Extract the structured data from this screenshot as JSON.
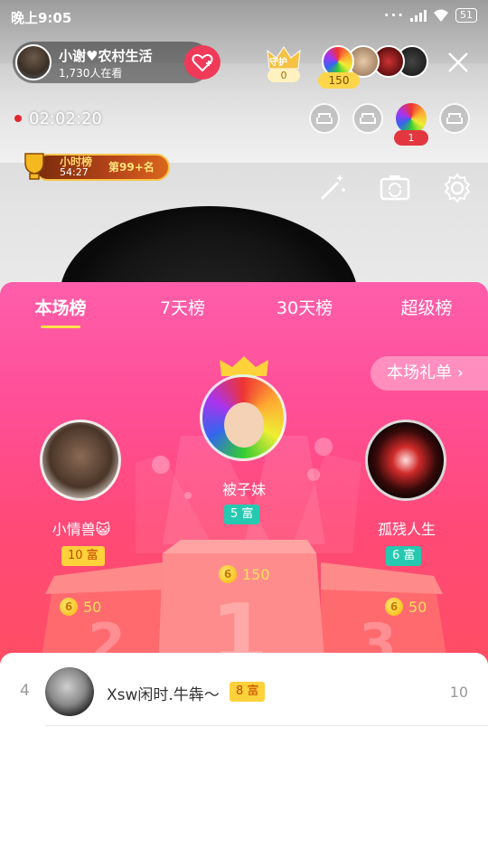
{
  "status_bar": {
    "time": "晚上9:05",
    "battery": "51"
  },
  "host": {
    "name": "小谢♥农村生活",
    "viewers": "1,730人在看"
  },
  "guard": {
    "label": "守护",
    "count": "0"
  },
  "viewers": {
    "count": "150"
  },
  "timer": "02:02:20",
  "seats": {
    "occupied_count": "1"
  },
  "hour_rank": {
    "title": "小时榜",
    "time": "54:27",
    "rank": "第99+名"
  },
  "tabs": [
    {
      "label": "本场榜"
    },
    {
      "label": "7天榜"
    },
    {
      "label": "30天榜"
    },
    {
      "label": "超级榜"
    }
  ],
  "gift_list_label": "本场礼单",
  "podium": {
    "first": {
      "name": "被子妹",
      "fu": "5 富",
      "coins": "150",
      "place": "1"
    },
    "second": {
      "name": "小情兽😺",
      "fu": "10 富",
      "coins": "50",
      "place": "2"
    },
    "third": {
      "name": "孤残人生",
      "fu": "6 富",
      "coins": "50",
      "place": "3"
    }
  },
  "list": [
    {
      "index": "4",
      "name": "Xsw闲时.牛犇～",
      "fu": "8 富",
      "score": "10"
    }
  ],
  "colors": {
    "panel_top": "#ff5eab",
    "panel_bottom": "#ff4d62",
    "accent_yellow": "#ffe34a",
    "teal": "#26c9b0"
  }
}
